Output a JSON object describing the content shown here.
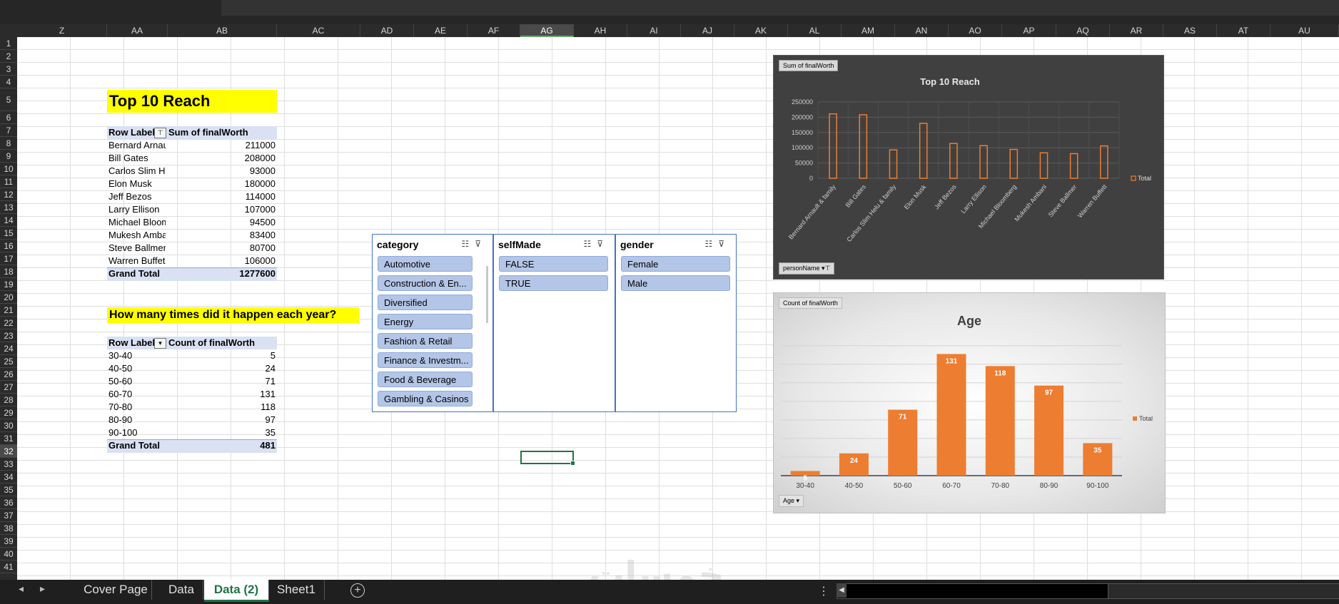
{
  "columns": [
    "Z",
    "AA",
    "AB",
    "AC",
    "AD",
    "AE",
    "AF",
    "AG",
    "AH",
    "AI",
    "AJ",
    "AK",
    "AL",
    "AM",
    "AN",
    "AO",
    "AP",
    "AQ",
    "AR",
    "AS",
    "AT",
    "AU"
  ],
  "rows": [
    "1",
    "2",
    "3",
    "4",
    "5",
    "6",
    "7",
    "8",
    "9",
    "10",
    "11",
    "12",
    "13",
    "14",
    "15",
    "16",
    "17",
    "18",
    "19",
    "20",
    "21",
    "22",
    "23",
    "24",
    "25",
    "26",
    "27",
    "28",
    "29",
    "30",
    "31",
    "32",
    "33",
    "34",
    "35",
    "36",
    "37",
    "38",
    "39",
    "40",
    "41"
  ],
  "selected_column": "AG",
  "selected_row": "32",
  "pivot1": {
    "heading": "Top 10 Reach",
    "row_labels_header": "Row Labels",
    "value_header": "Sum of finalWorth",
    "rows": [
      {
        "label": "Bernard Arnau",
        "value": "211000"
      },
      {
        "label": "Bill Gates",
        "value": "208000"
      },
      {
        "label": "Carlos Slim Hel",
        "value": "93000"
      },
      {
        "label": "Elon Musk",
        "value": "180000"
      },
      {
        "label": "Jeff Bezos",
        "value": "114000"
      },
      {
        "label": "Larry Ellison",
        "value": "107000"
      },
      {
        "label": "Michael Bloom",
        "value": "94500"
      },
      {
        "label": "Mukesh Amba",
        "value": "83400"
      },
      {
        "label": "Steve Ballmer",
        "value": "80700"
      },
      {
        "label": "Warren Buffet",
        "value": "106000"
      }
    ],
    "grand_total_label": "Grand Total",
    "grand_total_value": "1277600"
  },
  "pivot2": {
    "heading": "How many times did it happen each year?",
    "row_labels_header": "Row Labels",
    "value_header": "Count of finalWorth",
    "rows": [
      {
        "label": "30-40",
        "value": "5"
      },
      {
        "label": "40-50",
        "value": "24"
      },
      {
        "label": "50-60",
        "value": "71"
      },
      {
        "label": "60-70",
        "value": "131"
      },
      {
        "label": "70-80",
        "value": "118"
      },
      {
        "label": "80-90",
        "value": "97"
      },
      {
        "label": "90-100",
        "value": "35"
      }
    ],
    "grand_total_label": "Grand Total",
    "grand_total_value": "481"
  },
  "slicers": {
    "category": {
      "title": "category",
      "items": [
        "Automotive",
        "Construction & En...",
        "Diversified",
        "Energy",
        "Fashion & Retail",
        "Finance & Investm...",
        "Food & Beverage",
        "Gambling & Casinos"
      ]
    },
    "selfMade": {
      "title": "selfMade",
      "items": [
        "FALSE",
        "TRUE"
      ]
    },
    "gender": {
      "title": "gender",
      "items": [
        "Female",
        "Male"
      ]
    }
  },
  "chart1": {
    "value_field_button": "Sum of finalWorth",
    "axis_field_button": "personName",
    "legend": "Total"
  },
  "chart2": {
    "value_field_button": "Count of finalWorth",
    "axis_field_button": "Age",
    "legend": "Total"
  },
  "chart_data": [
    {
      "type": "bar",
      "title": "Top 10 Reach",
      "categories": [
        "Bernard Arnault & family",
        "Bill Gates",
        "Carlos Slim Helu & family",
        "Elon Musk",
        "Jeff Bezos",
        "Larry Ellison",
        "Michael Bloomberg",
        "Mukesh Ambani",
        "Steve Ballmer",
        "Warren Buffett"
      ],
      "series": [
        {
          "name": "Total",
          "values": [
            211000,
            208000,
            93000,
            180000,
            114000,
            107000,
            94500,
            83400,
            80700,
            106000
          ]
        }
      ],
      "yticks": [
        "0",
        "50000",
        "100000",
        "150000",
        "200000",
        "250000"
      ],
      "ylim": [
        0,
        250000
      ],
      "grid": true,
      "legend": "right",
      "bar_color": "#ed7d31"
    },
    {
      "type": "bar",
      "title": "Age",
      "categories": [
        "30-40",
        "40-50",
        "50-60",
        "60-70",
        "70-80",
        "80-90",
        "90-100"
      ],
      "series": [
        {
          "name": "Total",
          "values": [
            5,
            24,
            71,
            131,
            118,
            97,
            35
          ]
        }
      ],
      "data_labels": [
        "5",
        "24",
        "71",
        "131",
        "118",
        "97",
        "35"
      ],
      "ylim": [
        0,
        140
      ],
      "grid": true,
      "legend": "right",
      "bar_color": "#ed7d31"
    }
  ],
  "sheet_tabs": [
    "Cover Page",
    "Data",
    "Data (2)",
    "Sheet1"
  ],
  "active_tab": "Data (2)",
  "watermark": "خمسات",
  "colors": {
    "accent": "#217346",
    "pivot_header": "#d9e1f2",
    "slicer_item": "#b4c6e7",
    "highlight": "#ffff00",
    "bar": "#ed7d31"
  },
  "icons": [
    "multi-select-icon",
    "clear-filter-icon",
    "filter-dropdown-icon",
    "add-sheet-icon",
    "scroll-left-icon",
    "scroll-right-icon"
  ]
}
